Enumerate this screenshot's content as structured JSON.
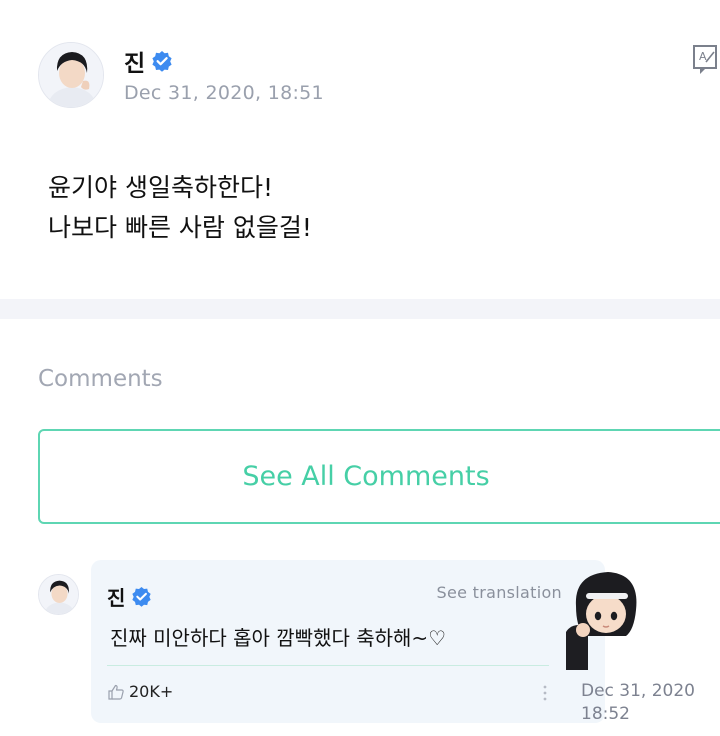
{
  "post": {
    "author": "진",
    "date": "Dec 31, 2020, 18:51",
    "body_line1": "윤기야 생일축하한다!",
    "body_line2": "나보다 빠른 사람 없을걸!"
  },
  "comments": {
    "title": "Comments",
    "see_all_label": "See All Comments",
    "items": [
      {
        "author": "진",
        "text": "진짜 미안하다 홉아 깜빡했다 축하해~♡",
        "see_translation": "See translation",
        "likes": "20K+",
        "date_line1": "Dec 31, 2020",
        "date_line2": "18:52"
      }
    ]
  },
  "icons": {
    "verified": "verified-badge-icon",
    "translate": "translate-icon",
    "like": "thumbs-up-icon",
    "more": "more-vertical-icon"
  },
  "colors": {
    "accent": "#46cfa6",
    "verified": "#3d8bf0",
    "muted": "#9aa0ad",
    "bubble": "#f1f6fb"
  }
}
